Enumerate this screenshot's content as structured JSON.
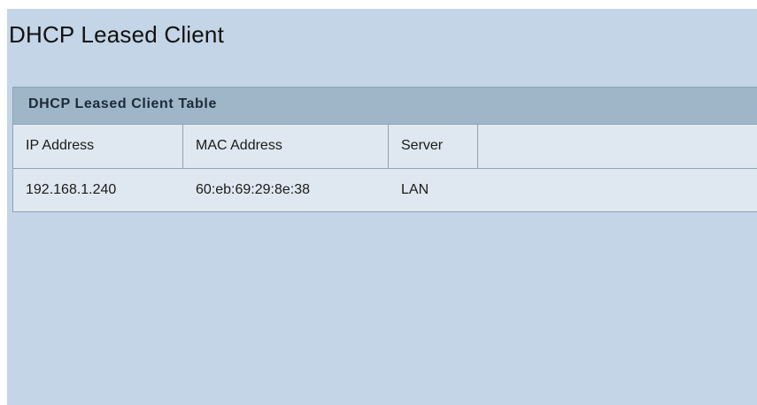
{
  "page": {
    "title": "DHCP Leased Client"
  },
  "table": {
    "caption": "DHCP Leased Client Table",
    "columns": [
      "IP Address",
      "MAC Address",
      "Server",
      ""
    ],
    "rows": [
      {
        "ip": "192.168.1.240",
        "mac": "60:eb:69:29:8e:38",
        "server": "LAN"
      }
    ]
  },
  "colors": {
    "page_background": "#c3d5e6",
    "caption_background": "#9fb6c9",
    "row_background": "#dfe8f0",
    "border": "#8ea3b6"
  }
}
